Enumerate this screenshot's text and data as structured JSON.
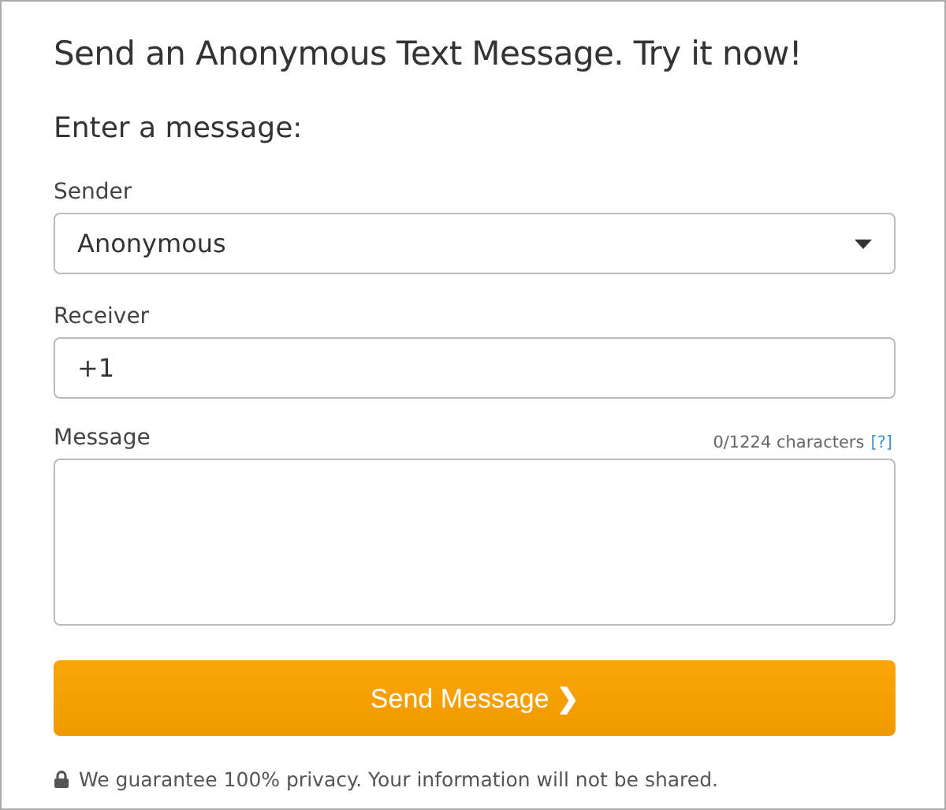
{
  "title": "Send an Anonymous Text Message. Try it now!",
  "subtitle": "Enter a message:",
  "sender": {
    "label": "Sender",
    "value": "Anonymous"
  },
  "receiver": {
    "label": "Receiver",
    "value": "+1"
  },
  "message": {
    "label": "Message",
    "counter": "0/1224 characters",
    "help_link": "[?]"
  },
  "send_button": {
    "label": "Send Message",
    "chevron": "❯"
  },
  "privacy_note": "We guarantee 100% privacy. Your information will not be shared."
}
